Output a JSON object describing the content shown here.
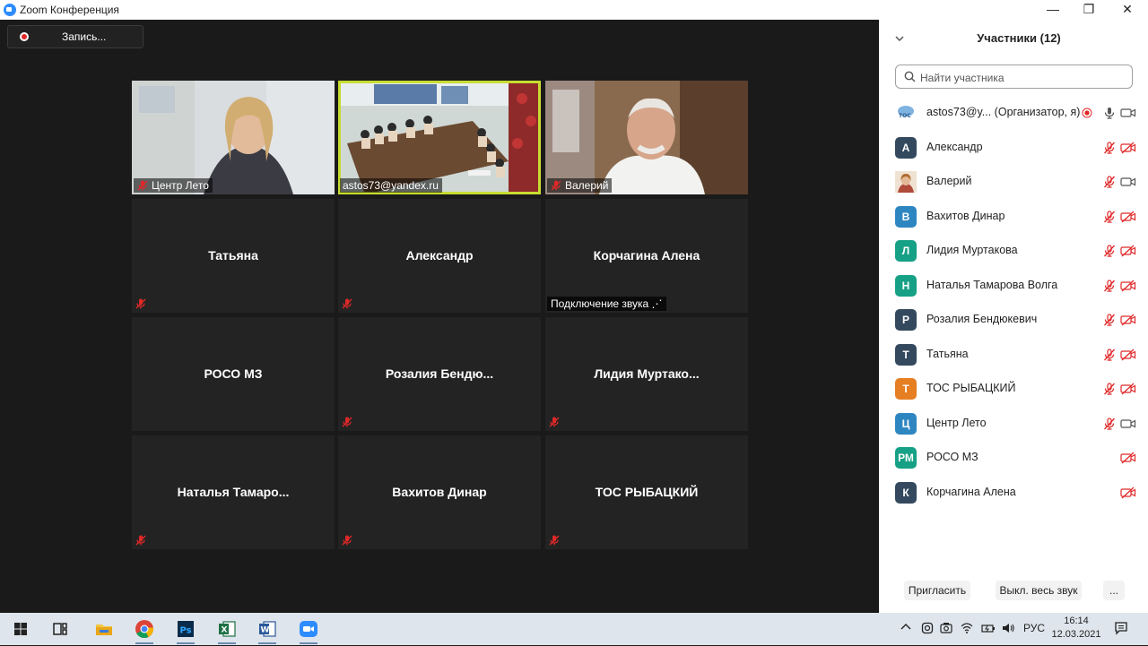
{
  "window": {
    "title": "Zoom Конференция",
    "controls": [
      "—",
      "❐",
      "✕"
    ]
  },
  "recording": {
    "label": "Запись..."
  },
  "tiles": [
    {
      "name": "Центр Лето",
      "video": true,
      "muted": true,
      "kind": "woman"
    },
    {
      "name": "astos73@yandex.ru",
      "video": true,
      "muted": false,
      "kind": "room",
      "active": true
    },
    {
      "name": "Валерий",
      "video": true,
      "muted": true,
      "kind": "man"
    },
    {
      "name": "Татьяна",
      "video": false,
      "muted": true
    },
    {
      "name": "Александр",
      "video": false,
      "muted": true
    },
    {
      "name": "Корчагина Алена",
      "video": false,
      "muted": false,
      "status": "Подключение звука ⋰"
    },
    {
      "name": "РОСО МЗ",
      "video": false,
      "muted": false
    },
    {
      "name": "Розалия  Бендю...",
      "video": false,
      "muted": true
    },
    {
      "name": "Лидия  Муртако...",
      "video": false,
      "muted": true
    },
    {
      "name": "Наталья  Тамаро...",
      "video": false,
      "muted": true
    },
    {
      "name": "Вахитов Динар",
      "video": false,
      "muted": true
    },
    {
      "name": "ТОС РЫБАЦКИЙ",
      "video": false,
      "muted": true
    }
  ],
  "panel": {
    "title": "Участники (12)",
    "search_placeholder": "Найти участника",
    "participants": [
      {
        "initials": "",
        "name": "astos73@y...  (Организатор, я)",
        "color": "#ffffff",
        "avatar": "logo",
        "mic": "on",
        "cam": "on",
        "recording": true
      },
      {
        "initials": "А",
        "name": "Александр",
        "color": "#34495e",
        "mic": "muted",
        "cam": "off"
      },
      {
        "initials": "",
        "name": "Валерий",
        "color": "#c98a5c",
        "avatar": "photo",
        "mic": "muted",
        "cam": "on"
      },
      {
        "initials": "В",
        "name": "Вахитов Динар",
        "color": "#2e86c1",
        "mic": "muted",
        "cam": "off"
      },
      {
        "initials": "Л",
        "name": "Лидия Муртакова",
        "color": "#16a085",
        "mic": "muted",
        "cam": "off"
      },
      {
        "initials": "Н",
        "name": "Наталья Тамарова Волга",
        "color": "#16a085",
        "mic": "muted",
        "cam": "off"
      },
      {
        "initials": "Р",
        "name": "Розалия Бендюкевич",
        "color": "#34495e",
        "mic": "muted",
        "cam": "off"
      },
      {
        "initials": "Т",
        "name": "Татьяна",
        "color": "#34495e",
        "mic": "muted",
        "cam": "off"
      },
      {
        "initials": "Т",
        "name": "ТОС РЫБАЦКИЙ",
        "color": "#e67e22",
        "mic": "muted",
        "cam": "off"
      },
      {
        "initials": "Ц",
        "name": "Центр Лето",
        "color": "#2e86c1",
        "mic": "muted",
        "cam": "on"
      },
      {
        "initials": "РМ",
        "name": "РОСО МЗ",
        "color": "#16a085",
        "mic": "none",
        "cam": "off"
      },
      {
        "initials": "К",
        "name": "Корчагина Алена",
        "color": "#34495e",
        "mic": "none",
        "cam": "off"
      }
    ],
    "invite_label": "Пригласить",
    "mute_all_label": "Выкл. весь звук",
    "more_label": "..."
  },
  "taskbar": {
    "lang": "РУС",
    "time": "16:14",
    "date": "12.03.2021"
  },
  "colors": {
    "accent": "#2d8cff",
    "muted": "#e02828",
    "active_outline": "#c8dc32"
  }
}
